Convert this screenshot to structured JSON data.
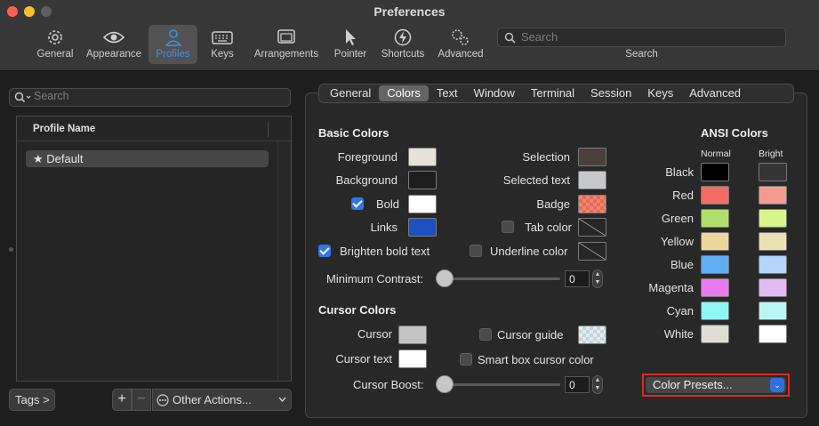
{
  "window": {
    "title": "Preferences",
    "traffic_colors": [
      "#fe5f57",
      "#febc2e",
      "#5e5e5e"
    ]
  },
  "toolbar": {
    "items": [
      {
        "label": "General",
        "icon": "gear-icon"
      },
      {
        "label": "Appearance",
        "icon": "eye-icon"
      },
      {
        "label": "Profiles",
        "icon": "person-icon",
        "active": true
      },
      {
        "label": "Keys",
        "icon": "keyboard-icon"
      },
      {
        "label": "Arrangements",
        "icon": "windows-icon"
      },
      {
        "label": "Pointer",
        "icon": "pointer-icon"
      },
      {
        "label": "Shortcuts",
        "icon": "bolt-icon"
      },
      {
        "label": "Advanced",
        "icon": "gears-icon"
      }
    ],
    "search_placeholder": "Search",
    "search_caption": "Search",
    "active_color": "#3d8ef5"
  },
  "sidebar": {
    "search_placeholder": "Search",
    "column_header": "Profile Name",
    "profiles": [
      {
        "name": "Default",
        "star": "★"
      }
    ],
    "tags_button": "Tags >",
    "add": "+",
    "remove": "−",
    "other_actions": "Other Actions..."
  },
  "tabs": [
    "General",
    "Colors",
    "Text",
    "Window",
    "Terminal",
    "Session",
    "Keys",
    "Advanced"
  ],
  "selected_tab": "Colors",
  "basic_colors": {
    "title": "Basic Colors",
    "foreground": {
      "label": "Foreground",
      "color": "#e6e1d9"
    },
    "background": {
      "label": "Background",
      "color": "#1e1e1e"
    },
    "bold": {
      "label": "Bold",
      "color": "#ffffff",
      "checked": true
    },
    "links": {
      "label": "Links",
      "color": "#1b4fc2"
    },
    "selection": {
      "label": "Selection",
      "color": "#4a3f3d"
    },
    "selected_text": {
      "label": "Selected text",
      "color": "#c6c8cb"
    },
    "badge": {
      "label": "Badge"
    },
    "tab_color": {
      "label": "Tab color",
      "checked": false
    },
    "brighten_bold": {
      "label": "Brighten bold text",
      "checked": true
    },
    "underline_color": {
      "label": "Underline color",
      "checked": false
    },
    "min_contrast": {
      "label": "Minimum Contrast:",
      "value": "0"
    }
  },
  "cursor_colors": {
    "title": "Cursor Colors",
    "cursor": {
      "label": "Cursor",
      "color": "#c4c4c4"
    },
    "cursor_text": {
      "label": "Cursor text",
      "color": "#ffffff"
    },
    "cursor_guide": {
      "label": "Cursor guide",
      "checked": false
    },
    "smart_box": {
      "label": "Smart box cursor color",
      "checked": false
    },
    "cursor_boost": {
      "label": "Cursor Boost:",
      "value": "0"
    }
  },
  "ansi": {
    "title": "ANSI Colors",
    "normal_header": "Normal",
    "bright_header": "Bright",
    "rows": [
      {
        "name": "Black",
        "normal": "#000000",
        "bright": "#343434"
      },
      {
        "name": "Red",
        "normal": "#f26c63",
        "bright": "#f39b91"
      },
      {
        "name": "Green",
        "normal": "#b1de6b",
        "bright": "#d9f48d"
      },
      {
        "name": "Yellow",
        "normal": "#ebd69c",
        "bright": "#ece1b2"
      },
      {
        "name": "Blue",
        "normal": "#62aef5",
        "bright": "#b3d4fb"
      },
      {
        "name": "Magenta",
        "normal": "#ea7af0",
        "bright": "#e2baf6"
      },
      {
        "name": "Cyan",
        "normal": "#8ff7f3",
        "bright": "#baf7f4"
      },
      {
        "name": "White",
        "normal": "#e0ddd5",
        "bright": "#ffffff"
      }
    ]
  },
  "presets": {
    "label": "Color Presets...",
    "highlight_color": "#e0281f"
  }
}
